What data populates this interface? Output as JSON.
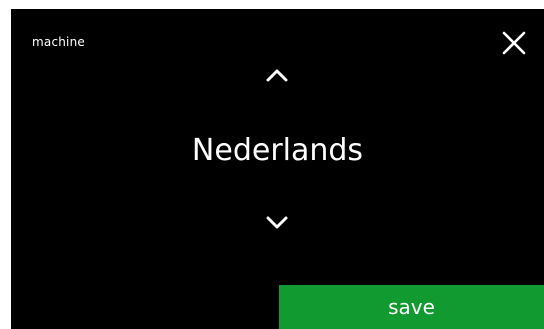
{
  "header": {
    "title": "machine"
  },
  "icons": {
    "close": "close-icon",
    "up": "chevron-up-icon",
    "down": "chevron-down-icon"
  },
  "selector": {
    "value": "Nederlands"
  },
  "actions": {
    "save_label": "save"
  },
  "colors": {
    "background": "#000000",
    "text": "#ffffff",
    "save_button": "#119a2f"
  }
}
